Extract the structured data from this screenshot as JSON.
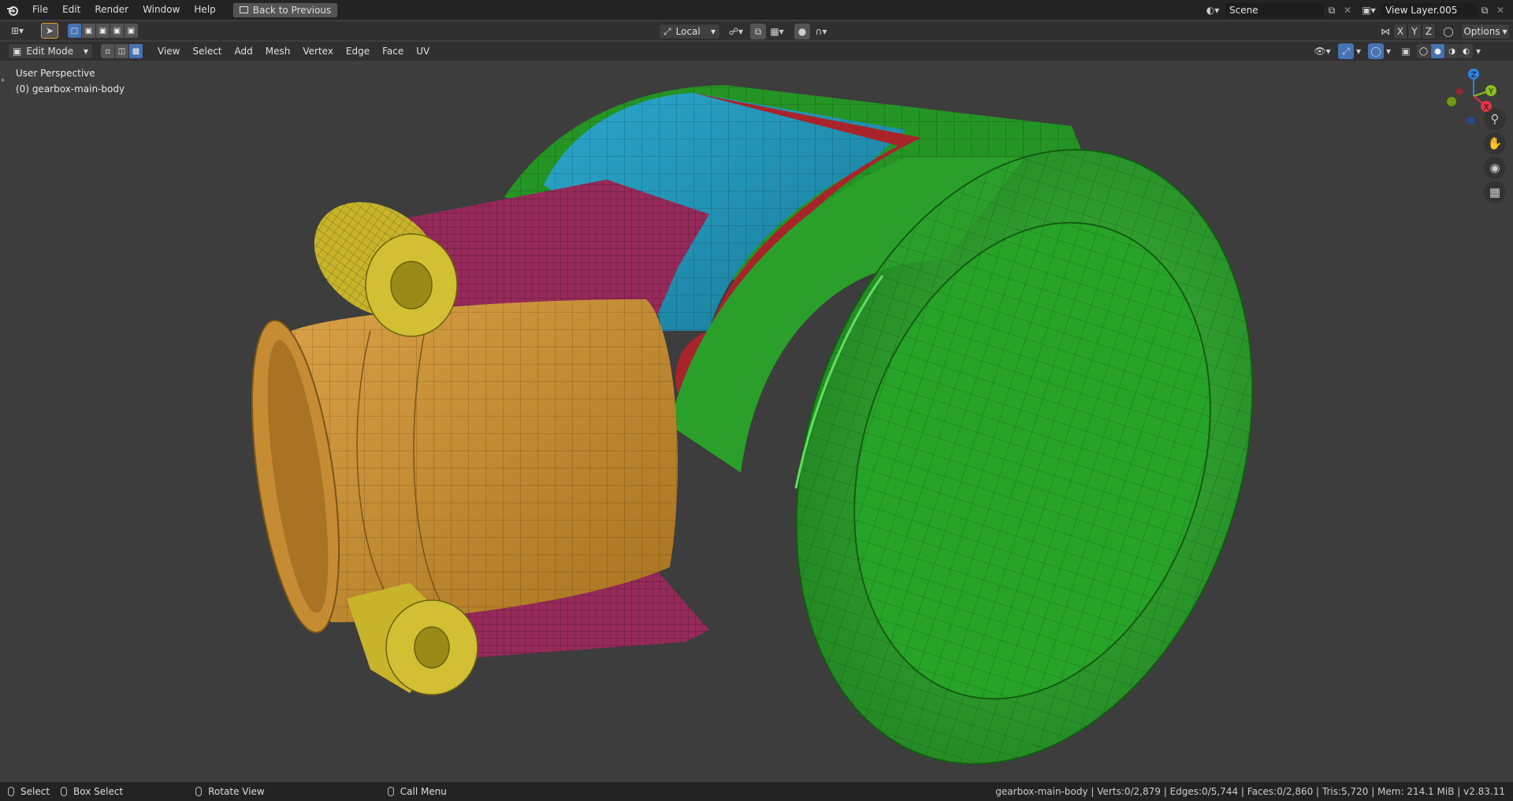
{
  "topbar": {
    "menus": [
      "File",
      "Edit",
      "Render",
      "Window",
      "Help"
    ],
    "back_button": "Back to Previous",
    "scene_name": "Scene",
    "view_layer": "View Layer.005"
  },
  "tool_header": {
    "transform_orientation": "Local",
    "axes": [
      "X",
      "Y",
      "Z"
    ],
    "options_label": "Options"
  },
  "viewport_header": {
    "mode": "Edit Mode",
    "menus": [
      "View",
      "Select",
      "Add",
      "Mesh",
      "Vertex",
      "Edge",
      "Face",
      "UV"
    ]
  },
  "viewport": {
    "perspective_label": "User Perspective",
    "object_label": "(0) gearbox-main-body",
    "gizmo_axes": {
      "z": "Z",
      "y": "Y",
      "x": "X"
    },
    "colors": {
      "background": "#3d3d3d",
      "green": "#2a9a2a",
      "blue": "#1f94b8",
      "red": "#a8242a",
      "magenta": "#9a2a5c",
      "orange": "#c89036",
      "yellow": "#c8b42a"
    }
  },
  "statusbar": {
    "hints": [
      {
        "icon": "mouse-left-icon",
        "label": "Select"
      },
      {
        "icon": "mouse-drag-icon",
        "label": "Box Select"
      },
      {
        "icon": "mouse-middle-icon",
        "label": "Rotate View"
      },
      {
        "icon": "mouse-right-icon",
        "label": "Call Menu"
      }
    ],
    "stats": "gearbox-main-body | Verts:0/2,879 | Edges:0/5,744 | Faces:0/2,860 | Tris:5,720 | Mem: 214.1 MiB | v2.83.11"
  }
}
